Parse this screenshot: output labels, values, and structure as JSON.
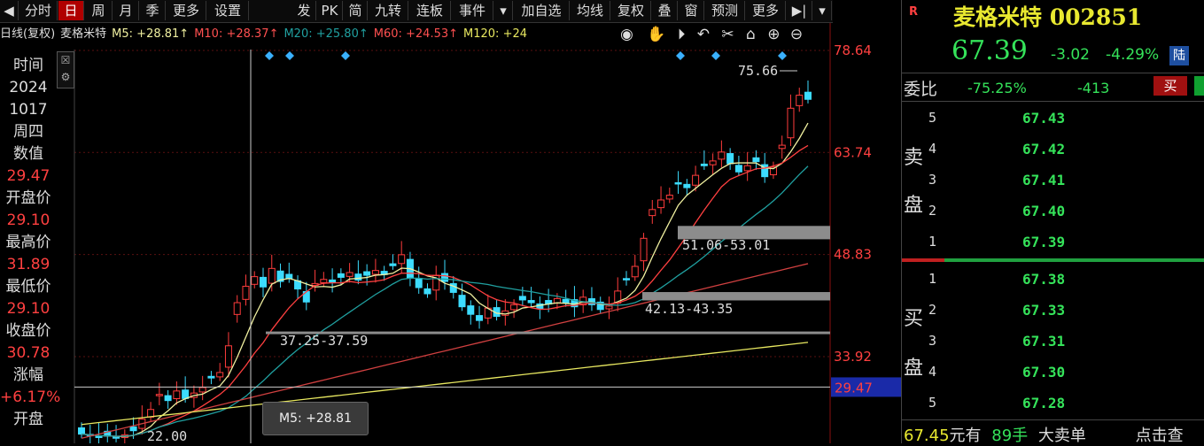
{
  "toolbar": {
    "items": [
      "分时",
      "日",
      "周",
      "月",
      "季",
      "更多",
      "设置",
      "发",
      "PK",
      "简",
      "九转",
      "连板",
      "事件",
      "加自选",
      "均线",
      "复权",
      "叠",
      "窗",
      "预测",
      "更多"
    ]
  },
  "ma_bar": {
    "prefix": "日线(复权)",
    "stock": "麦格米特",
    "m5": "M5: +28.81↑",
    "m10": "M10: +28.37↑",
    "m20": "M20: +25.80↑",
    "m60": "M60: +24.53↑",
    "m120": "M120: +24"
  },
  "left_panel": {
    "time_label": "时间",
    "year": "2024",
    "date": "1017",
    "weekday": "周四",
    "value_label": "数值",
    "value": "29.47",
    "open_label": "开盘价",
    "open": "29.10",
    "high_label": "最高价",
    "high": "31.89",
    "low_label": "最低价",
    "low": "29.10",
    "close_label": "收盘价",
    "close": "30.78",
    "change_label": "涨幅",
    "change": "+6.17%",
    "open2_label": "开盘"
  },
  "chart": {
    "axis_labels": [
      "78.64",
      "63.74",
      "48.83",
      "33.92"
    ],
    "crosshair_value": "29.47",
    "peak_label": "75.66",
    "low_label": "22.00",
    "zone_labels": [
      "51.06-53.01",
      "42.13-43.35",
      "37.25-37.59"
    ],
    "tooltip": "M5: +28.81"
  },
  "chart_data": {
    "type": "candlestick",
    "price_axis_ticks": [
      78.64,
      63.74,
      48.83,
      33.92
    ],
    "crosshair": 29.47,
    "peak": 75.66,
    "low": 22.0,
    "support_zones": [
      [
        51.06,
        53.01
      ],
      [
        42.13,
        43.35
      ],
      [
        37.25,
        37.59
      ]
    ],
    "closes": [
      22.6,
      22.4,
      22.1,
      22.3,
      22.0,
      22.5,
      23.1,
      24.8,
      26.2,
      28.4,
      27.5,
      28.9,
      27.8,
      28.6,
      29.4,
      30.8,
      31.6,
      35.5,
      41.8,
      44.2,
      45.6,
      44.1,
      46.8,
      44.9,
      45.3,
      43.8,
      41.9,
      44.6,
      45.2,
      44.8,
      45.5,
      46.2,
      45.1,
      45.8,
      46.5,
      45.9,
      47.2,
      48.8,
      45.4,
      44.0,
      43.1,
      45.8,
      44.9,
      43.3,
      41.2,
      40.1,
      39.2,
      41.0,
      39.8,
      40.6,
      41.5,
      42.2,
      41.8,
      40.9,
      41.6,
      42.4,
      41.8,
      41.2,
      42.6,
      41.5,
      40.8,
      41.3,
      43.5,
      45.2,
      47.1,
      51.2,
      55.4,
      56.8,
      57.5,
      59.2,
      58.6,
      60.4,
      61.8,
      62.5,
      63.8,
      62.1,
      60.9,
      61.8,
      62.4,
      60.2,
      61.6,
      64.8,
      70.2,
      72.1,
      71.5
    ]
  },
  "quote": {
    "badge": "R",
    "name": "麦格米特",
    "code": "002851",
    "price": "67.39",
    "change": "-3.02",
    "change_pct": "-4.29%",
    "market_tag": "陆",
    "ratio_label": "委比",
    "ratio": "-75.25%",
    "diff": "-413",
    "buy_btn": "买"
  },
  "orderbook": {
    "sell_label_1": "卖",
    "sell_label_2": "盘",
    "buy_label_1": "买",
    "buy_label_2": "盘",
    "asks": [
      {
        "level": "5",
        "price": "67.43"
      },
      {
        "level": "4",
        "price": "67.42"
      },
      {
        "level": "3",
        "price": "67.41"
      },
      {
        "level": "2",
        "price": "67.40"
      },
      {
        "level": "1",
        "price": "67.39"
      }
    ],
    "bids": [
      {
        "level": "1",
        "price": "67.38"
      },
      {
        "level": "2",
        "price": "67.33"
      },
      {
        "level": "3",
        "price": "67.31"
      },
      {
        "level": "4",
        "price": "67.30"
      },
      {
        "level": "5",
        "price": "67.28"
      }
    ]
  },
  "footer": {
    "price": "67.45",
    "text1": "元有",
    "qty": "89手",
    "text2": "大卖单",
    "text3": "点击查"
  },
  "colors": {
    "up": "#ff3c3c",
    "down": "#3cdcff",
    "ma5": "#f0f0a0",
    "ma10": "#ff4040",
    "ma20": "#20a0a0",
    "ma60": "#d04040",
    "ma120": "#e8e860"
  }
}
